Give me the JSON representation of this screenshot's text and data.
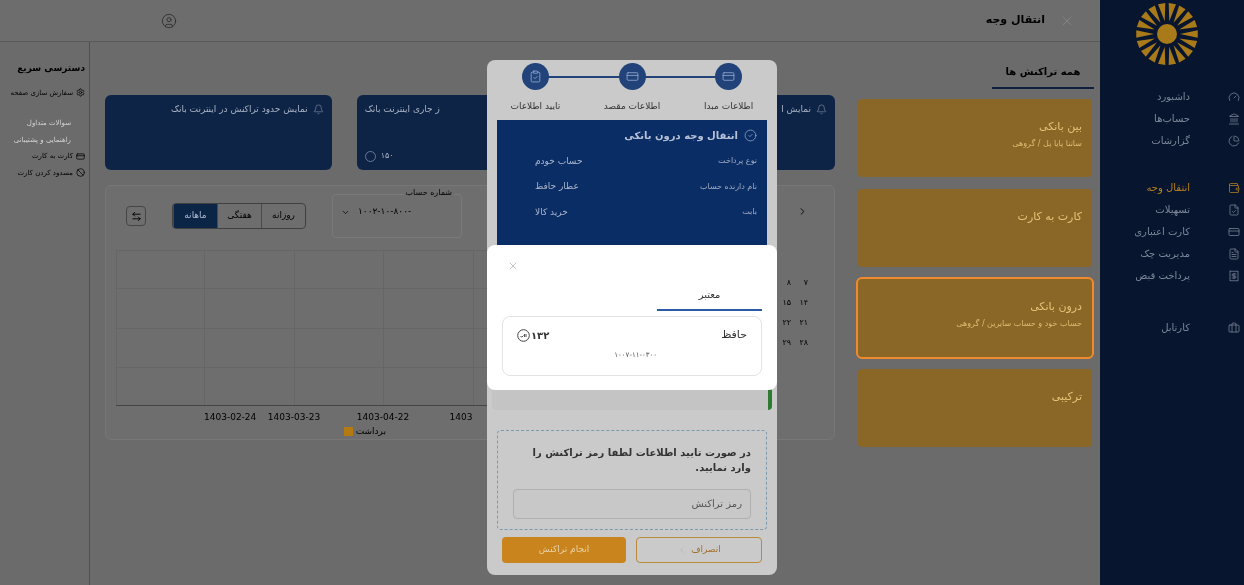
{
  "sidebar": {
    "groups": [
      {
        "items": [
          {
            "label": "داشبورد",
            "selected": false
          },
          {
            "label": "حساب‌ها",
            "selected": false
          },
          {
            "label": "گزارشات",
            "selected": false
          }
        ]
      },
      {
        "items": [
          {
            "label": "انتقال وجه",
            "selected": true
          },
          {
            "label": "تسهیلات",
            "selected": false
          },
          {
            "label": "کارت اعتباری",
            "selected": false
          },
          {
            "label": "مدیریت چک",
            "selected": false
          },
          {
            "label": "پرداخت قبض",
            "selected": false
          }
        ]
      },
      {
        "items": [
          {
            "label": "کارتابل",
            "selected": false
          }
        ]
      }
    ]
  },
  "header": {
    "title": "انتقال وجه"
  },
  "transfer": {
    "tabs": [
      {
        "label": "همه تراکنش ها",
        "selected": true
      }
    ],
    "options": [
      {
        "title": "بین بانکی",
        "subtitle": "ساتنا پایا پل / گروهی",
        "selected": false
      },
      {
        "title": "کارت به کارت",
        "selected": false
      },
      {
        "title": "درون بانکی",
        "subtitle": "حساب خود و حساب سایرین / گروهی",
        "selected": true
      },
      {
        "title": "ترکیبی",
        "selected": false
      }
    ]
  },
  "dashboard": {
    "cards": [
      {
        "title": "نمایش ا"
      },
      {
        "title": "ز جاری اینترنت بانک",
        "value": "۱۵۰"
      },
      {
        "title": "نمایش حدود تراکنش در اینترنت بانک"
      }
    ],
    "chart_panel": {
      "account_label": "شماره حساب",
      "account_value": "۱۰۰۲-۱۰-۸۰۰-",
      "periods": [
        {
          "label": "روزانه",
          "selected": false
        },
        {
          "label": "هفتگی",
          "selected": false
        },
        {
          "label": "ماهانه",
          "selected": true
        }
      ],
      "x_labels": [
        "1403",
        "1403-04-22",
        "1403-03-23",
        "1403-02-24"
      ],
      "legend": "برداشت"
    },
    "calendar": {
      "rows": [
        [
          "۷",
          "۸"
        ],
        [
          "۱۴",
          "۱۵"
        ],
        [
          "۲۱",
          "۲۲"
        ],
        [
          "۲۸",
          "۲۹"
        ]
      ]
    }
  },
  "quick_access": {
    "title": "دسترسی سریع",
    "items": [
      {
        "label": "سفارش سازی صفحه",
        "disabled": false
      },
      {
        "label": "سوالات متداول",
        "disabled": true
      },
      {
        "label": "راهنمایی و پشتیبانی",
        "disabled": true
      },
      {
        "label": "کارت به کارت",
        "disabled": false
      },
      {
        "label": "مسدود کردن کارت",
        "disabled": false
      }
    ]
  },
  "stepper": {
    "steps": [
      {
        "label": "اطلاعات مبدا"
      },
      {
        "label": "اطلاعات مقصد"
      },
      {
        "label": "تایید اطلاعات"
      }
    ],
    "summary": {
      "title": "انتقال وجه درون بانکی",
      "rows": [
        {
          "label": "نوع پرداخت",
          "value": "حساب خودم"
        },
        {
          "label": "نام دارنده حساب",
          "value": "عطار حافظ"
        },
        {
          "label": "بابت",
          "value": "خرید کالا"
        }
      ]
    },
    "prompt": "در صورت تایید اطلاعات لطفا رمز تراکنش را وارد نمایید.",
    "password": {
      "placeholder": "رمز تراکنش"
    },
    "buttons": [
      {
        "label": "انصراف",
        "kind": "cancel"
      },
      {
        "label": "انجام تراکنش",
        "kind": "primary"
      }
    ]
  },
  "account_dialog": {
    "tabs": [
      {
        "label": "معتبر",
        "selected": true
      }
    ],
    "account": {
      "name": "حافظ",
      "amount": "۱۳۲",
      "number": "۱۰۰۷-۱۱-۰۳۰۰"
    }
  }
}
